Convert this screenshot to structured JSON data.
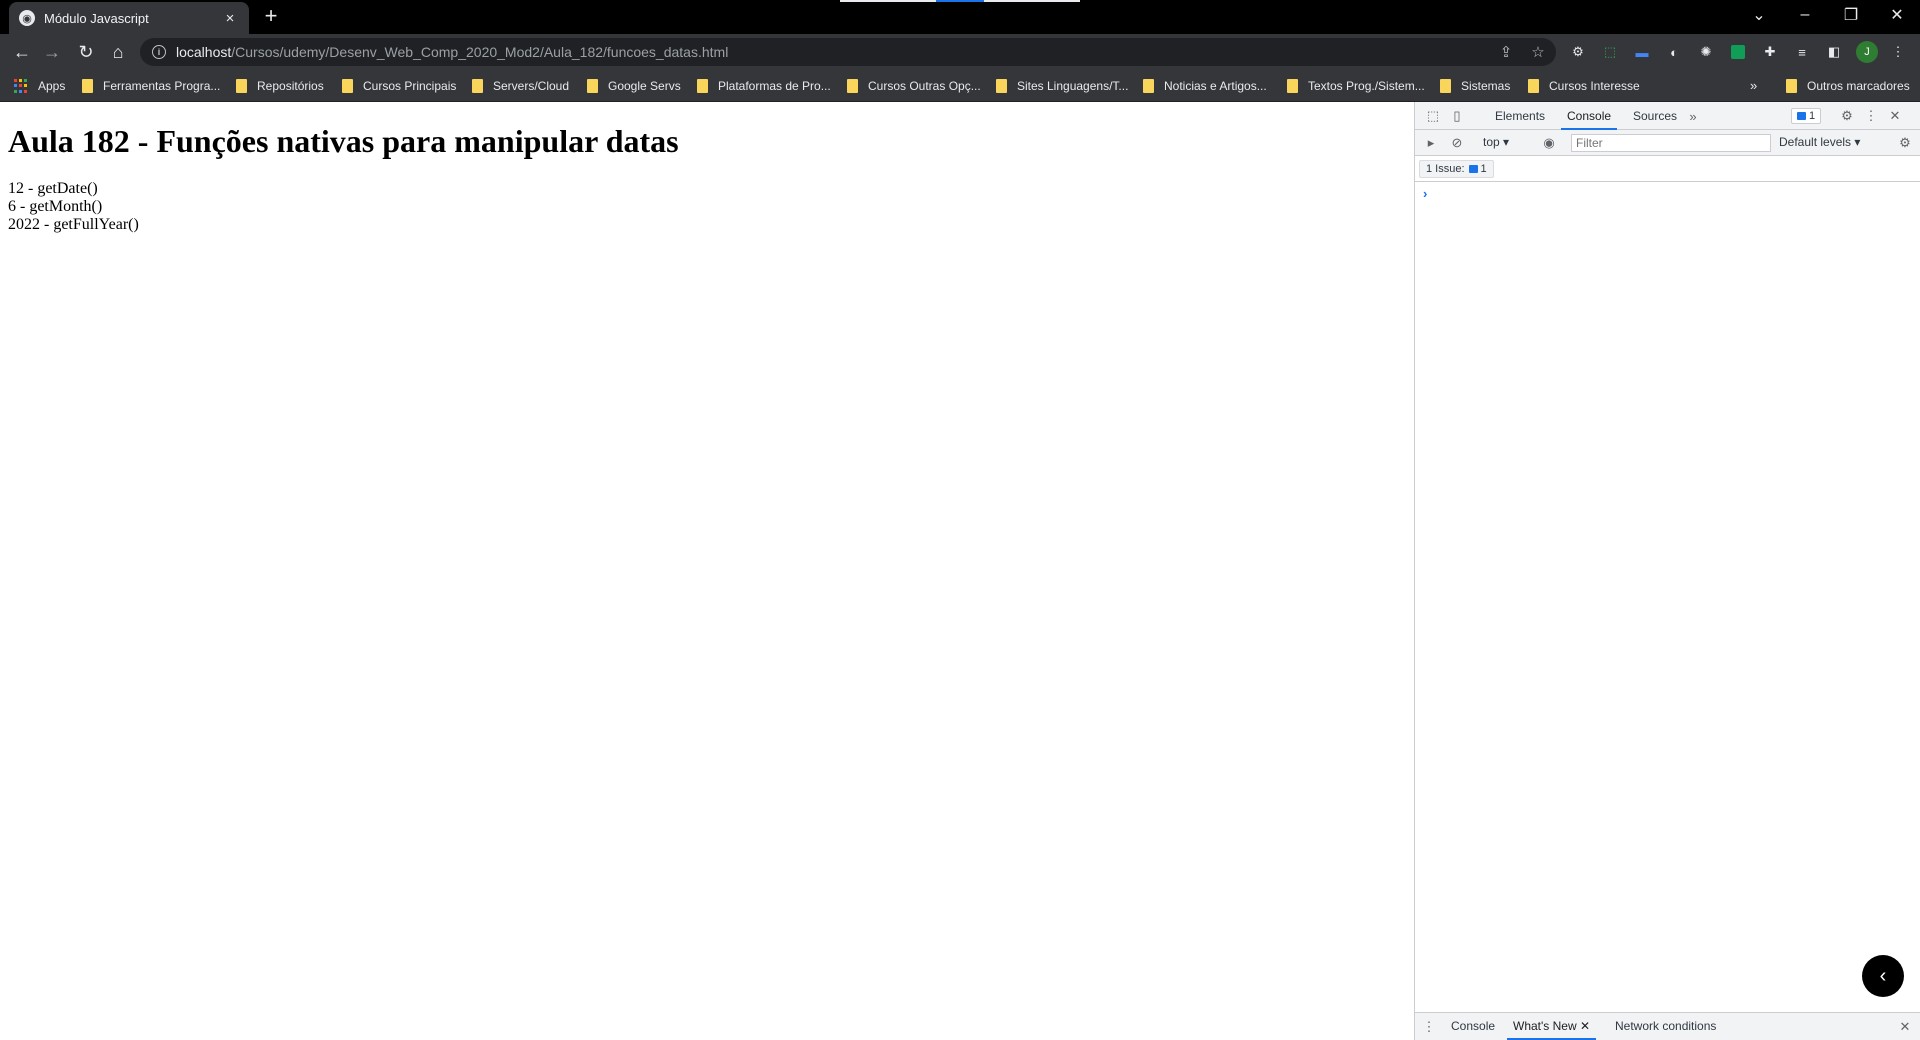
{
  "browser": {
    "tab": {
      "title": "Módulo Javascript",
      "close_icon": "×"
    },
    "new_tab_icon": "+",
    "window_controls": {
      "tab_search": "⌄",
      "minimize": "–",
      "restore": "❐",
      "close": "✕"
    },
    "url": {
      "host": "localhost",
      "path": "/Cursos/udemy/Desenv_Web_Comp_2020_Mod2/Aula_182/funcoes_datas.html"
    },
    "avatar_letter": "J",
    "bookmarks": [
      "Apps",
      "Ferramentas Progra...",
      "Repositórios",
      "Cursos Principais",
      "Servers/Cloud",
      "Google Servs",
      "Plataformas de Pro...",
      "Cursos Outras Opç...",
      "Sites Linguagens/T...",
      "Noticias e Artigos...",
      "Textos Prog./Sistem...",
      "Sistemas",
      "Cursos Interesse"
    ],
    "bookmarks_more": "»",
    "other_bookmarks": "Outros marcadores"
  },
  "page": {
    "heading": "Aula 182 - Funções nativas para manipular datas",
    "lines": [
      "12 - getDate()",
      "6 - getMonth()",
      "2022 - getFullYear()"
    ]
  },
  "devtools": {
    "tabs": [
      "Elements",
      "Console",
      "Sources"
    ],
    "more_tabs": "»",
    "issue_count": "1",
    "context": "top",
    "filter_placeholder": "Filter",
    "levels": "Default levels",
    "issues_label": "1 Issue:",
    "issues_count": "1",
    "prompt_symbol": "›",
    "drawer_tabs": [
      "Console",
      "What's New",
      "Network conditions"
    ]
  },
  "colors": {
    "accent": "#1a73e8",
    "folder": "#f9d55b",
    "toolbar": "#35363a",
    "tabstrip": "#000000"
  }
}
